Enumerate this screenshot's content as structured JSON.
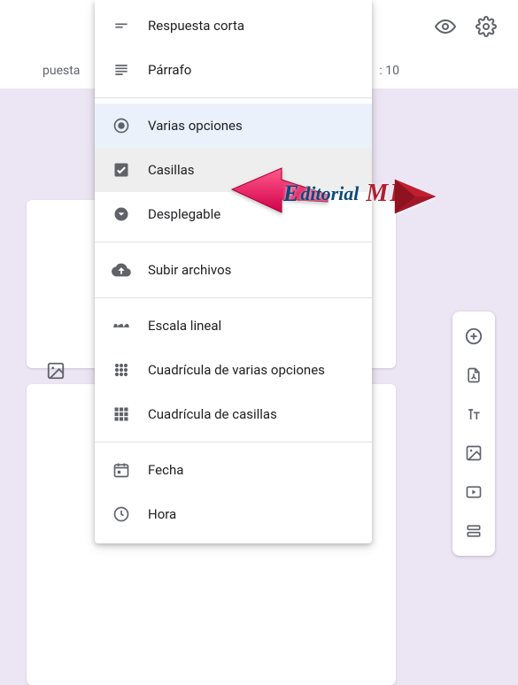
{
  "topbar": {
    "preview_icon": "preview",
    "settings_icon": "settings"
  },
  "tabsbar": {
    "left_text": "puesta",
    "right_text": ": 10"
  },
  "menu": {
    "items": [
      {
        "label": "Respuesta corta",
        "icon": "short-text",
        "state": "normal"
      },
      {
        "label": "Párrafo",
        "icon": "paragraph",
        "state": "normal"
      },
      {
        "sep": true
      },
      {
        "label": "Varias opciones",
        "icon": "radio",
        "state": "selected"
      },
      {
        "label": "Casillas",
        "icon": "checkbox",
        "state": "active"
      },
      {
        "label": "Desplegable",
        "icon": "dropdown",
        "state": "normal"
      },
      {
        "sep": true
      },
      {
        "label": "Subir archivos",
        "icon": "upload",
        "state": "normal"
      },
      {
        "sep": true
      },
      {
        "label": "Escala lineal",
        "icon": "linear",
        "state": "normal"
      },
      {
        "label": "Cuadrícula de varias opciones",
        "icon": "grid-radio",
        "state": "normal"
      },
      {
        "label": "Cuadrícula de casillas",
        "icon": "grid-check",
        "state": "normal"
      },
      {
        "sep": true
      },
      {
        "label": "Fecha",
        "icon": "date",
        "state": "normal"
      },
      {
        "label": "Hora",
        "icon": "time",
        "state": "normal"
      }
    ]
  },
  "rail": {
    "add": "add",
    "import": "import",
    "title": "title",
    "image": "image",
    "video": "video",
    "section": "section"
  },
  "watermark": {
    "text1": "E",
    "text2": "ditorial",
    "text3": "M",
    "text4": "D"
  }
}
